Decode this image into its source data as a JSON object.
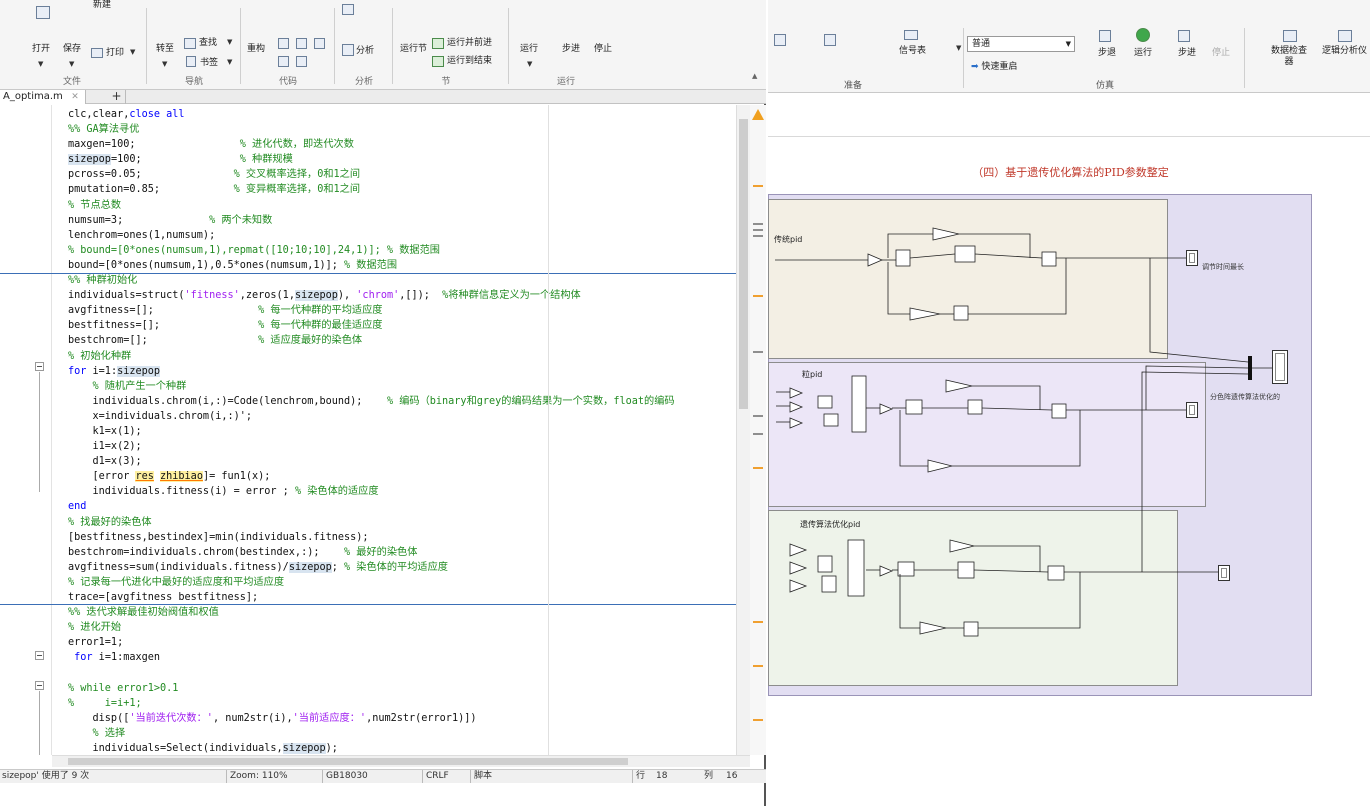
{
  "editor": {
    "ribbon": {
      "buttons": [
        {
          "label": "打开"
        },
        {
          "label": "保存"
        },
        {
          "label": "新建"
        },
        {
          "label": "打印"
        },
        {
          "label": "转至"
        },
        {
          "label": "查找"
        },
        {
          "label": "书签"
        },
        {
          "label": "重构"
        },
        {
          "label": "分析"
        },
        {
          "label": "运行节"
        },
        {
          "label": "运行并前进"
        },
        {
          "label": "运行到结束"
        },
        {
          "label": "运行"
        },
        {
          "label": "步进"
        },
        {
          "label": "停止"
        }
      ],
      "groups": [
        "文件",
        "导航",
        "代码",
        "分析",
        "节",
        "运行"
      ]
    },
    "file_tab": "A_optima.m",
    "add_tab": "+",
    "code_lines": [
      "clc,clear,close all",
      "%% GA算法寻优",
      "maxgen=100;                 % 进化代数，即迭代次数",
      "sizepop=100;                % 种群规模",
      "pcross=0.05;               % 交叉概率选择，0和1之间",
      "pmutation=0.85;            % 变异概率选择，0和1之间",
      "% 节点总数",
      "numsum=3;              % 两个未知数",
      "lenchrom=ones(1,numsum);",
      "% bound=[0*ones(numsum,1),repmat([10;10;10],24,1)]; % 数据范围",
      "bound=[0*ones(numsum,1),0.5*ones(numsum,1)]; % 数据范围",
      "%% 种群初始化",
      "individuals=struct('fitness',zeros(1,sizepop), 'chrom',[]);  %将种群信息定义为一个结构体",
      "avgfitness=[];                 % 每一代种群的平均适应度",
      "bestfitness=[];                % 每一代种群的最佳适应度",
      "bestchrom=[];                  % 适应度最好的染色体",
      "% 初始化种群",
      "for i=1:sizepop",
      "    % 随机产生一个种群",
      "    individuals.chrom(i,:)=Code(lenchrom,bound);    % 编码（binary和grey的编码结果为一个实数，float的编码",
      "    x=individuals.chrom(i,:)';",
      "    k1=x(1);",
      "    i1=x(2);",
      "    d1=x(3);",
      "    [error res zhibiao]= fun1(x);",
      "    individuals.fitness(i) = error ; % 染色体的适应度",
      "end",
      "% 找最好的染色体",
      "[bestfitness,bestindex]=min(individuals.fitness);",
      "bestchrom=individuals.chrom(bestindex,:);    % 最好的染色体",
      "avgfitness=sum(individuals.fitness)/sizepop; % 染色体的平均适应度",
      "% 记录每一代进化中最好的适应度和平均适应度",
      "trace=[avgfitness bestfitness];",
      "%% 迭代求解最佳初始阀值和权值",
      "% 进化开始",
      "error1=1;",
      " for i=1:maxgen",
      "",
      "% while error1>0.1",
      "%     i=i+1;",
      "    disp(['当前迭代次数：', num2str(i),'当前适应度：',num2str(error1)])",
      "    % 选择",
      "    individuals=Select(individuals,sizepop);"
    ],
    "status": {
      "message": "sizepop' 使用了 9 次",
      "zoom": "Zoom: 110%",
      "encoding": "GB18030",
      "eol": "CRLF",
      "type": "脚本",
      "row_label": "行",
      "row": "18",
      "col_label": "列",
      "col": "16"
    }
  },
  "simulink": {
    "ribbon": {
      "buttons": [
        {
          "label": "信号表"
        },
        {
          "label": "普通"
        },
        {
          "label": "快速重启"
        },
        {
          "label": "步退"
        },
        {
          "label": "运行"
        },
        {
          "label": "步进"
        },
        {
          "label": "停止"
        },
        {
          "label": "数据检查器"
        },
        {
          "label": "逻辑分析仪"
        }
      ],
      "groups": [
        "准备",
        "仿真"
      ]
    },
    "diagram_title": "（四）基于遗传优化算法的PID参数整定",
    "subsystems": [
      {
        "label": "传统pid",
        "output_label": "调节时间最长"
      },
      {
        "label": "粒pid",
        "output_label": "分色阵遗传算法优化的"
      },
      {
        "label": "遗传算法优化pid"
      }
    ]
  }
}
